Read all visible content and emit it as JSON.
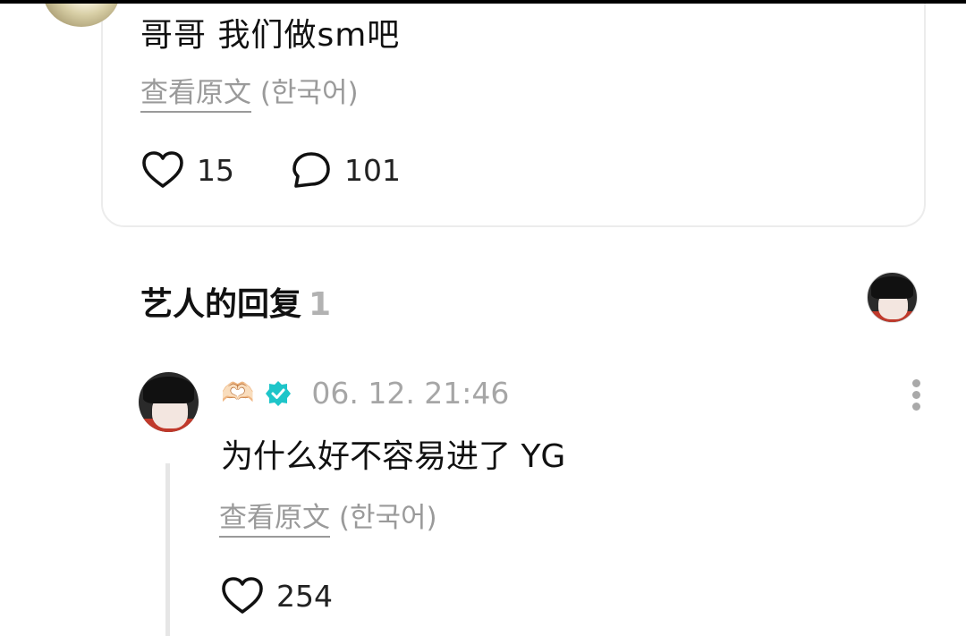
{
  "post": {
    "text": "哥哥 我们做sm吧",
    "translate_link": "查看原文",
    "translate_lang": "(한국어)",
    "likes": "15",
    "comments": "101"
  },
  "artist_replies": {
    "title": "艺人的回复",
    "count": "1"
  },
  "reply": {
    "emoji": "🫶🏻",
    "timestamp": "06. 12. 21:46",
    "text": "为什么好不容易进了 YG",
    "translate_link": "查看原文",
    "translate_lang": "(한국어)",
    "likes": "254"
  },
  "icons": {
    "like": "heart-outline-icon",
    "comment": "speech-bubble-icon",
    "verified": "verified-badge-icon",
    "more": "more-vertical-icon"
  },
  "colors": {
    "verified": "#1ec5c9",
    "muted": "#9a9a9a"
  }
}
